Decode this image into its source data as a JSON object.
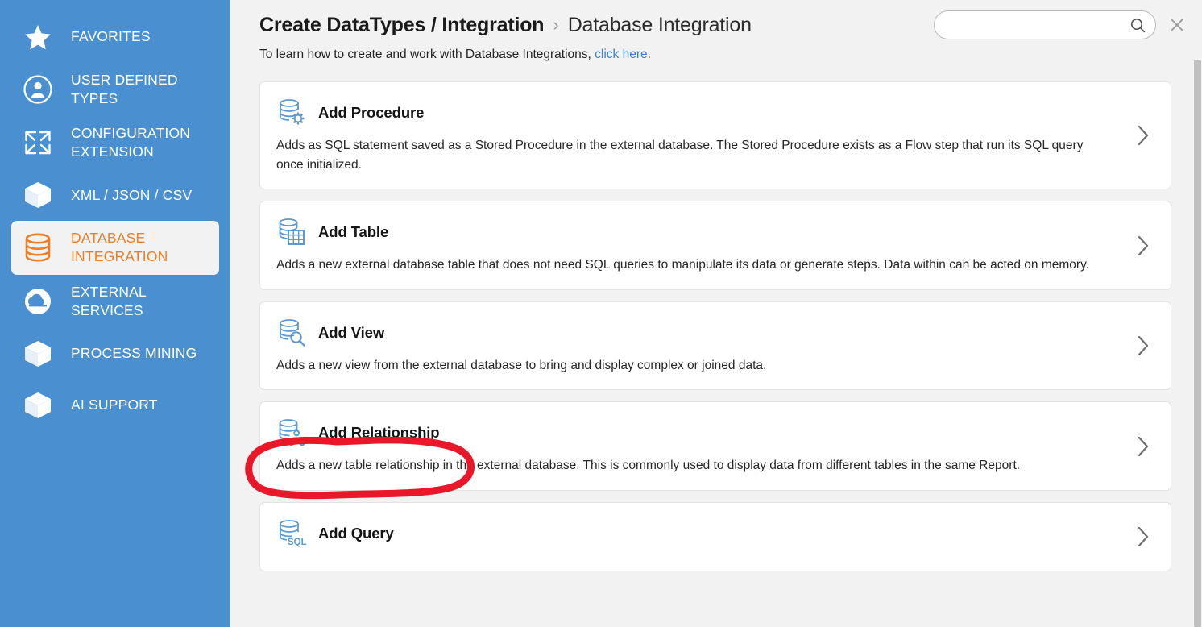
{
  "sidebar": {
    "background_color": "#4a8fd0",
    "selected_text_color": "#f07d20",
    "items": [
      {
        "label": "FAVORITES",
        "icon": "star-icon",
        "selected": false
      },
      {
        "label": "USER DEFINED TYPES",
        "icon": "user-circle-icon",
        "selected": false
      },
      {
        "label": "CONFIGURATION EXTENSION",
        "icon": "expand-arrows-icon",
        "selected": false
      },
      {
        "label": "XML / JSON / CSV",
        "icon": "cube-icon",
        "selected": false
      },
      {
        "label": "DATABASE INTEGRATION",
        "icon": "database-icon",
        "selected": true
      },
      {
        "label": "EXTERNAL SERVICES",
        "icon": "cloud-circle-icon",
        "selected": false
      },
      {
        "label": "PROCESS MINING",
        "icon": "cube-icon",
        "selected": false
      },
      {
        "label": "AI SUPPORT",
        "icon": "cube-icon",
        "selected": false
      }
    ]
  },
  "header": {
    "breadcrumb_parent": "Create DataTypes / Integration",
    "breadcrumb_separator": "›",
    "breadcrumb_current": "Database Integration",
    "subtitle_prefix": "To learn how to create and work with Database Integrations, ",
    "subtitle_link": "click here",
    "subtitle_suffix": ".",
    "search": {
      "value": "",
      "placeholder": "",
      "icon": "search-icon"
    },
    "close_icon": "close-icon"
  },
  "cards": [
    {
      "title": "Add Procedure",
      "icon": "database-gear-icon",
      "description": "Adds as SQL statement saved as a Stored Procedure in the external database. The Stored Procedure exists as a Flow step that run its SQL query once initialized.",
      "chevron": "chevron-right-icon"
    },
    {
      "title": "Add Table",
      "icon": "database-table-icon",
      "description": "Adds a new external database table that does not need SQL queries to manipulate its data or generate steps. Data within can be acted on memory.",
      "chevron": "chevron-right-icon"
    },
    {
      "title": "Add View",
      "icon": "database-search-icon",
      "description": "Adds a new view from the external database to bring and display complex or joined data.",
      "chevron": "chevron-right-icon"
    },
    {
      "title": "Add Relationship",
      "icon": "database-relationship-icon",
      "description": "Adds a new table relationship in the external database. This is commonly used to display data from different tables in the same Report.",
      "chevron": "chevron-right-icon",
      "annotated": true
    },
    {
      "title": "Add Query",
      "icon": "database-sql-icon",
      "description": "",
      "chevron": "chevron-right-icon"
    }
  ],
  "annotation": {
    "shape": "hand-drawn-ellipse",
    "color": "#e8172a",
    "targets": "Add Relationship"
  },
  "scrollbar": {
    "orientation": "vertical",
    "thumb_color": "#c0c0c0"
  }
}
